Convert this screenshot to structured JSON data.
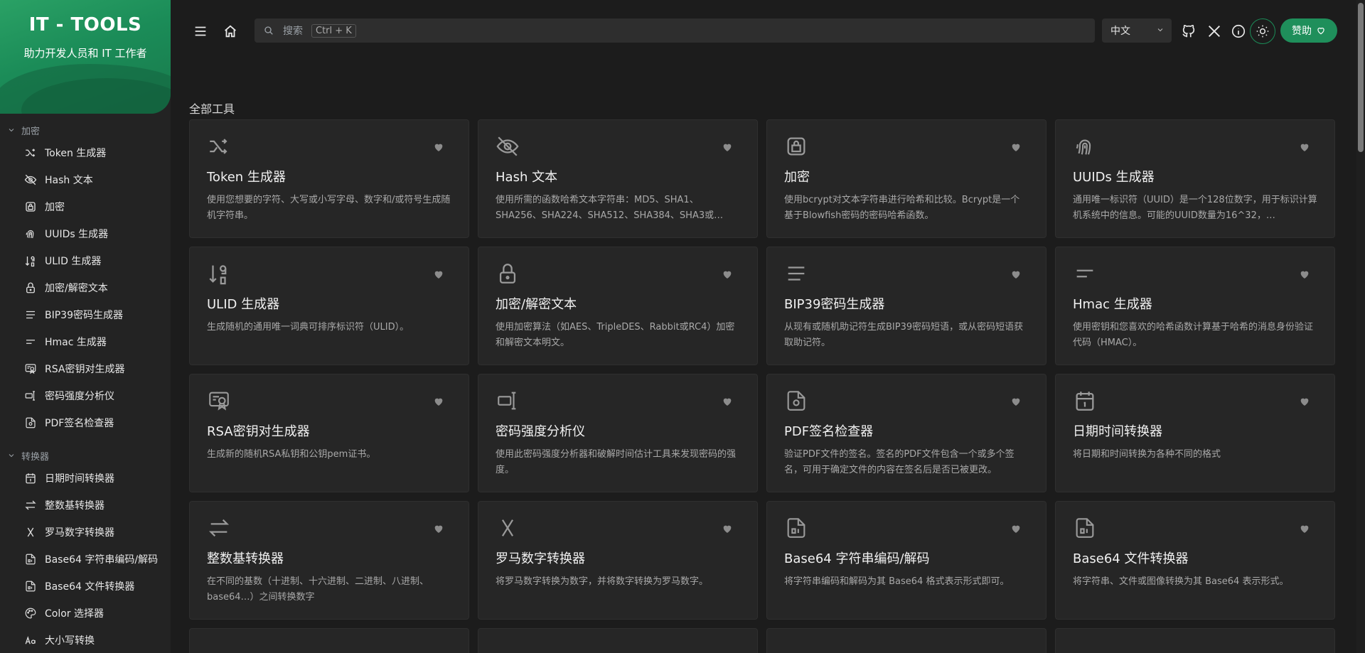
{
  "brand": {
    "title": "IT - TOOLS",
    "subtitle": "助力开发人员和 IT 工作者"
  },
  "sidebar": {
    "sections": [
      {
        "label": "加密",
        "items": [
          {
            "label": "Token 生成器",
            "icon": "shuffle-icon"
          },
          {
            "label": "Hash 文本",
            "icon": "eye-off-icon"
          },
          {
            "label": "加密",
            "icon": "lock-square-icon"
          },
          {
            "label": "UUIDs 生成器",
            "icon": "fingerprint-icon"
          },
          {
            "label": "ULID 生成器",
            "icon": "sort-numeric-icon"
          },
          {
            "label": "加密/解密文本",
            "icon": "lock-icon"
          },
          {
            "label": "BIP39密码生成器",
            "icon": "lines-icon"
          },
          {
            "label": "Hmac 生成器",
            "icon": "short-lines-icon"
          },
          {
            "label": "RSA密钥对生成器",
            "icon": "certificate-icon"
          },
          {
            "label": "密码强度分析仪",
            "icon": "password-icon"
          },
          {
            "label": "PDF签名检查器",
            "icon": "file-certificate-icon"
          }
        ]
      },
      {
        "label": "转换器",
        "items": [
          {
            "label": "日期时间转换器",
            "icon": "calendar-icon"
          },
          {
            "label": "整数基转换器",
            "icon": "arrows-exchange-icon"
          },
          {
            "label": "罗马数字转换器",
            "icon": "roman-x-icon"
          },
          {
            "label": "Base64 字符串编码/解码",
            "icon": "file-digit-icon"
          },
          {
            "label": "Base64 文件转换器",
            "icon": "file-digit-icon"
          },
          {
            "label": "Color 选择器",
            "icon": "palette-icon"
          },
          {
            "label": "大小写转换",
            "icon": "letter-case-icon"
          }
        ]
      }
    ]
  },
  "topbar": {
    "search_placeholder": "搜索",
    "search_shortcut": "Ctrl + K",
    "language": "中文",
    "sponsor_label": "赞助"
  },
  "main": {
    "section_title": "全部工具",
    "cards": [
      {
        "title": "Token 生成器",
        "desc": "使用您想要的字符、大写或小写字母、数字和/或符号生成随机字符串。",
        "icon": "shuffle-icon"
      },
      {
        "title": "Hash 文本",
        "desc": "使用所需的函数哈希文本字符串：MD5、SHA1、SHA256、SHA224、SHA512、SHA384、SHA3或…",
        "icon": "eye-off-icon"
      },
      {
        "title": "加密",
        "desc": "使用bcrypt对文本字符串进行哈希和比较。Bcrypt是一个基于Blowfish密码的密码哈希函数。",
        "icon": "lock-square-icon"
      },
      {
        "title": "UUIDs 生成器",
        "desc": "通用唯一标识符（UUID）是一个128位数字，用于标识计算机系统中的信息。可能的UUID数量为16^32，…",
        "icon": "fingerprint-icon"
      },
      {
        "title": "ULID 生成器",
        "desc": "生成随机的通用唯一词典可排序标识符（ULID）。",
        "icon": "sort-numeric-icon"
      },
      {
        "title": "加密/解密文本",
        "desc": "使用加密算法（如AES、TripleDES、Rabbit或RC4）加密和解密文本明文。",
        "icon": "lock-icon"
      },
      {
        "title": "BIP39密码生成器",
        "desc": "从现有或随机助记符生成BIP39密码短语，或从密码短语获取助记符。",
        "icon": "lines-icon"
      },
      {
        "title": "Hmac 生成器",
        "desc": "使用密钥和您喜欢的哈希函数计算基于哈希的消息身份验证代码（HMAC）。",
        "icon": "short-lines-icon"
      },
      {
        "title": "RSA密钥对生成器",
        "desc": "生成新的随机RSA私钥和公钥pem证书。",
        "icon": "certificate-icon"
      },
      {
        "title": "密码强度分析仪",
        "desc": "使用此密码强度分析器和破解时间估计工具来发现密码的强度。",
        "icon": "password-icon"
      },
      {
        "title": "PDF签名检查器",
        "desc": "验证PDF文件的签名。签名的PDF文件包含一个或多个签名，可用于确定文件的内容在签名后是否已被更改。",
        "icon": "file-certificate-icon"
      },
      {
        "title": "日期时间转换器",
        "desc": "将日期和时间转换为各种不同的格式",
        "icon": "calendar-icon"
      },
      {
        "title": "整数基转换器",
        "desc": "在不同的基数（十进制、十六进制、二进制、八进制、base64…）之间转换数字",
        "icon": "arrows-exchange-icon"
      },
      {
        "title": "罗马数字转换器",
        "desc": "将罗马数字转换为数字，并将数字转换为罗马数字。",
        "icon": "roman-x-icon"
      },
      {
        "title": "Base64 字符串编码/解码",
        "desc": "将字符串编码和解码为其 Base64 格式表示形式即可。",
        "icon": "file-digit-icon"
      },
      {
        "title": "Base64 文件转换器",
        "desc": "将字符串、文件或图像转换为其 Base64 表示形式。",
        "icon": "file-digit-icon"
      }
    ]
  },
  "colors": {
    "accent": "#1f8f5b",
    "background": "#1c1c1c",
    "card": "#262626"
  }
}
